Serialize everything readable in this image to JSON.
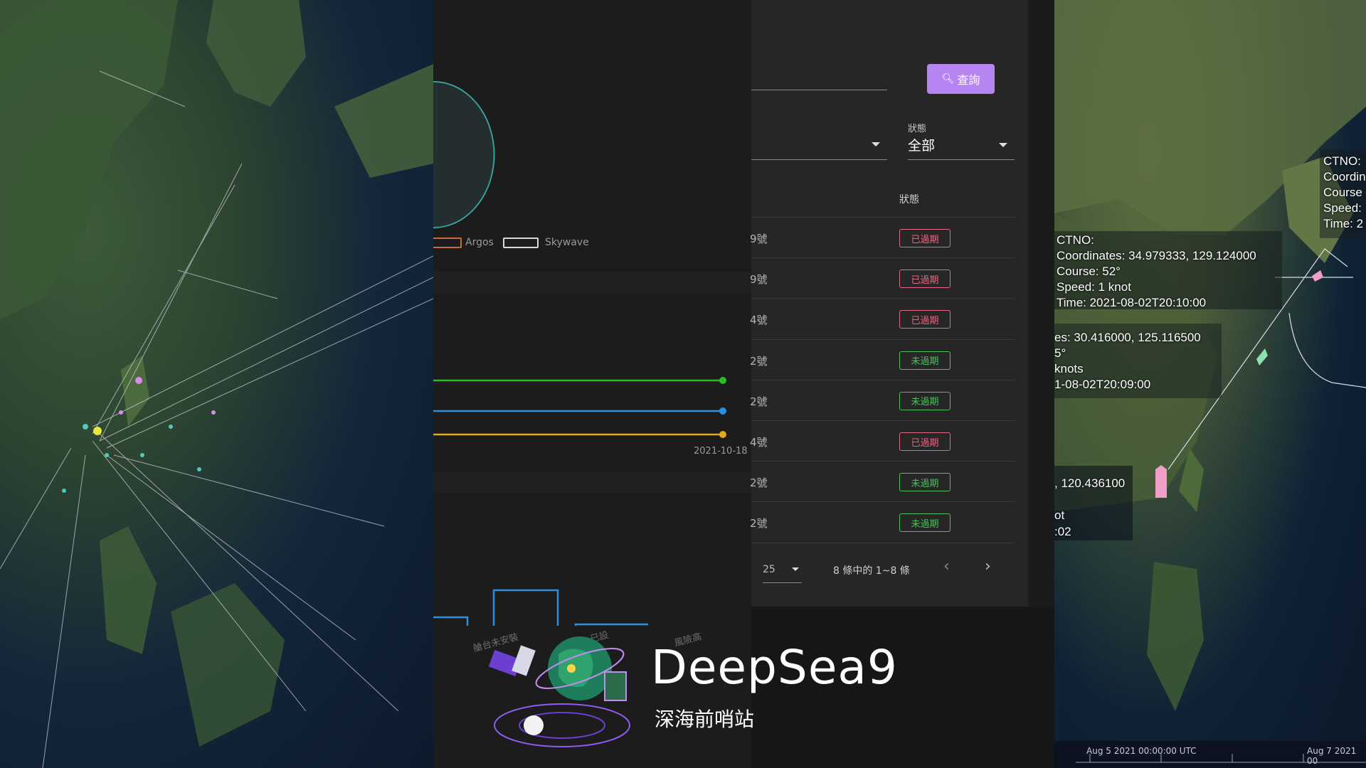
{
  "search": {
    "button_label": "查詢"
  },
  "filters": {
    "status_label": "狀態",
    "status_value": "全部"
  },
  "table": {
    "status_header": "狀態",
    "rows": [
      {
        "no": "9號",
        "status": "已過期"
      },
      {
        "no": "9號",
        "status": "已過期"
      },
      {
        "no": "4號",
        "status": "已過期"
      },
      {
        "no": "2號",
        "status": "未過期"
      },
      {
        "no": "2號",
        "status": "未過期"
      },
      {
        "no": "4號",
        "status": "已過期"
      },
      {
        "no": "2號",
        "status": "未過期"
      },
      {
        "no": "2號",
        "status": "未過期"
      }
    ],
    "rows_per_page": "25",
    "range_text": "8 條中的 1~8 條"
  },
  "chart": {
    "legend": [
      "Argos",
      "Skywave"
    ],
    "legend_colors": [
      "#c86a3a",
      "#d9d9d9"
    ],
    "date_label": "2021-10-18",
    "line_colors": [
      "#2bbb2b",
      "#2a8fe0",
      "#e0a81f"
    ],
    "bar_labels": [
      "艙台未安裝",
      "已設",
      "風險高"
    ]
  },
  "map_right": {
    "popup_main": {
      "ctno": "CTNO:",
      "coordinates": "Coordinates: 34.979333, 129.124000",
      "course": "Course: 52°",
      "speed": "Speed: 1 knot",
      "time": "Time: 2021-08-02T20:10:00"
    },
    "popup_second": {
      "coordinates": "es: 30.416000, 125.116500",
      "course": "5°",
      "speed": "knots",
      "time": "1-08-02T20:09:00"
    },
    "popup_top": {
      "ctno": "CTNO:",
      "coordinates": "Coordin",
      "course": "Course",
      "speed": "Speed:",
      "time": "Time: 2"
    },
    "popup_third": {
      "coordinates": ", 120.436100",
      "speed": "ot",
      "time": ":02"
    },
    "timeline_start": "Aug 5 2021 00:00:00 UTC",
    "timeline_end": "Aug 7 2021 00"
  },
  "brand": {
    "name": "DeepSea9",
    "subtitle": "深海前哨站"
  }
}
